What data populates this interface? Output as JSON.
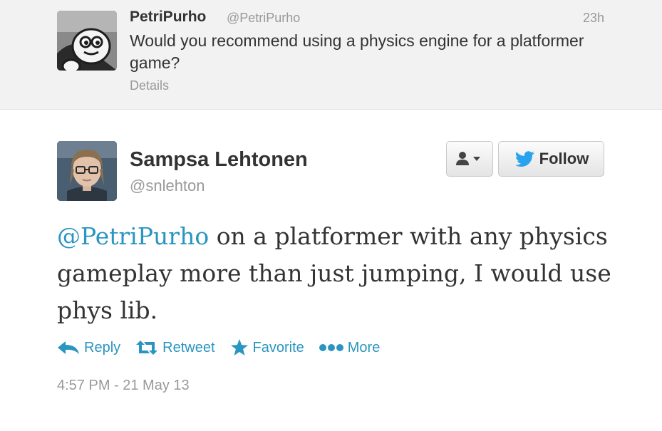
{
  "parent_tweet": {
    "name": "PetriPurho",
    "handle": "@PetriPurho",
    "time": "23h",
    "text": "Would you recommend using a physics engine for a platformer game?",
    "details_label": "Details"
  },
  "main_tweet": {
    "name": "Sampsa Lehtonen",
    "handle": "@snlehton",
    "follow_label": "Follow",
    "mention": "@PetriPurho",
    "text_rest": " on a platformer with any physics gameplay more than just jumping, I would use phys lib.",
    "timestamp": "4:57 PM - 21 May 13"
  },
  "actions": {
    "reply": "Reply",
    "retweet": "Retweet",
    "favorite": "Favorite",
    "more": "More"
  },
  "icons": {
    "reply": "reply-arrow-icon",
    "retweet": "retweet-icon",
    "favorite": "star-icon",
    "more": "more-dots-icon",
    "follow": "twitter-bird-icon",
    "user_menu": "person-icon"
  },
  "colors": {
    "link_blue": "#2a95c0",
    "twitter_blue": "#2aa3ef",
    "text_dark": "#333333",
    "text_muted": "#999999",
    "parent_bg": "#f2f2f2"
  }
}
